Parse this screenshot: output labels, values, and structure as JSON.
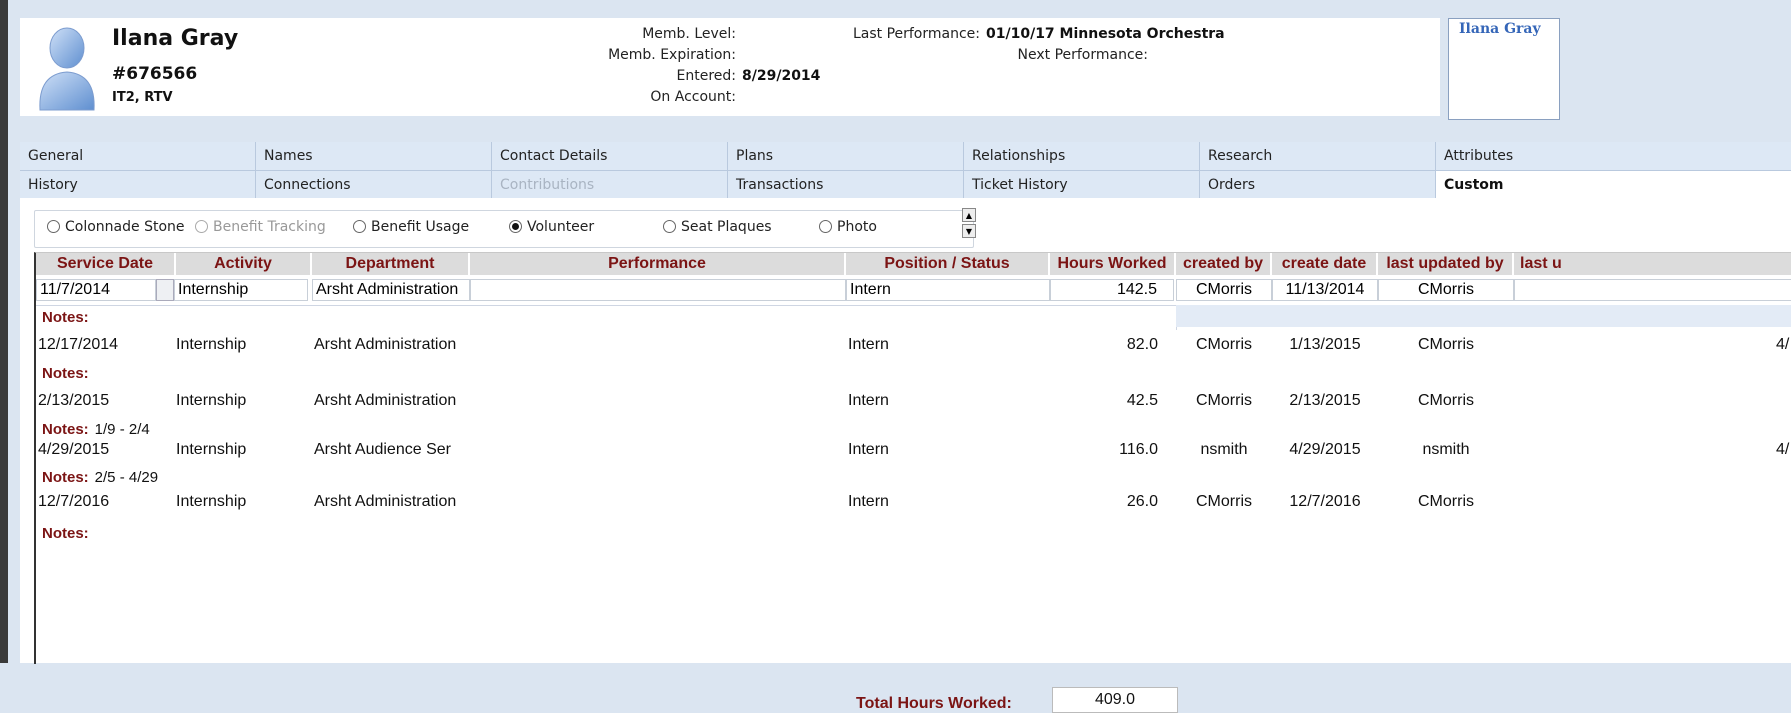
{
  "patron": {
    "name": "Ilana Gray",
    "id": "#676566",
    "codes": "IT2, RTV",
    "memb_level_label": "Memb. Level:",
    "memb_level": "",
    "memb_expiration_label": "Memb. Expiration:",
    "memb_expiration": "",
    "entered_label": "Entered:",
    "entered": "8/29/2014",
    "on_account_label": "On Account:",
    "on_account": "",
    "last_performance_label": "Last Performance:",
    "last_performance": "01/10/17 Minnesota Orchestra",
    "next_performance_label": "Next Performance:",
    "next_performance": "",
    "name_box": "Ilana Gray"
  },
  "tabs_row1": [
    "General",
    "Names",
    "Contact Details",
    "Plans",
    "Relationships",
    "Research",
    "Attributes"
  ],
  "tabs_row2": [
    "History",
    "Connections",
    "Contributions",
    "Transactions",
    "Ticket History",
    "Orders",
    "Custom"
  ],
  "radios": [
    "Colonnade Stone",
    "Benefit Tracking",
    "Benefit Usage",
    "Volunteer",
    "Seat Plaques",
    "Photo"
  ],
  "selected_radio": "Volunteer",
  "columns": [
    "Service Date",
    "Activity",
    "Department",
    "Performance",
    "Position / Status",
    "Hours Worked",
    "created by",
    "create date",
    "last updated by",
    "last u"
  ],
  "notes_label": "Notes:",
  "rows": [
    {
      "date": "11/7/2014",
      "activity": "Internship",
      "department": "Arsht Administration",
      "performance": "",
      "position": "Intern",
      "hours": "142.5",
      "created_by": "CMorris",
      "create_date": "11/13/2014",
      "updated_by": "CMorris",
      "last_u": "",
      "notes": ""
    },
    {
      "date": "12/17/2014",
      "activity": "Internship",
      "department": "Arsht Administration",
      "performance": "",
      "position": "Intern",
      "hours": "82.0",
      "created_by": "CMorris",
      "create_date": "1/13/2015",
      "updated_by": "CMorris",
      "last_u": "4/",
      "notes": ""
    },
    {
      "date": "2/13/2015",
      "activity": "Internship",
      "department": "Arsht Administration",
      "performance": "",
      "position": "Intern",
      "hours": "42.5",
      "created_by": "CMorris",
      "create_date": "2/13/2015",
      "updated_by": "CMorris",
      "last_u": "",
      "notes": "1/9 - 2/4"
    },
    {
      "date": "4/29/2015",
      "activity": "Internship",
      "department": "Arsht Audience Ser",
      "performance": "",
      "position": "Intern",
      "hours": "116.0",
      "created_by": "nsmith",
      "create_date": "4/29/2015",
      "updated_by": "nsmith",
      "last_u": "4/",
      "notes": "2/5 - 4/29"
    },
    {
      "date": "12/7/2016",
      "activity": "Internship",
      "department": "Arsht Administration",
      "performance": "",
      "position": "Intern",
      "hours": "26.0",
      "created_by": "CMorris",
      "create_date": "12/7/2016",
      "updated_by": "CMorris",
      "last_u": "",
      "notes": ""
    }
  ],
  "total_label": "Total Hours Worked:",
  "total_hours": "409.0",
  "colors": {
    "header_text": "#7b1414",
    "name_box_text": "#3566b8",
    "background": "#dbe5f1"
  }
}
